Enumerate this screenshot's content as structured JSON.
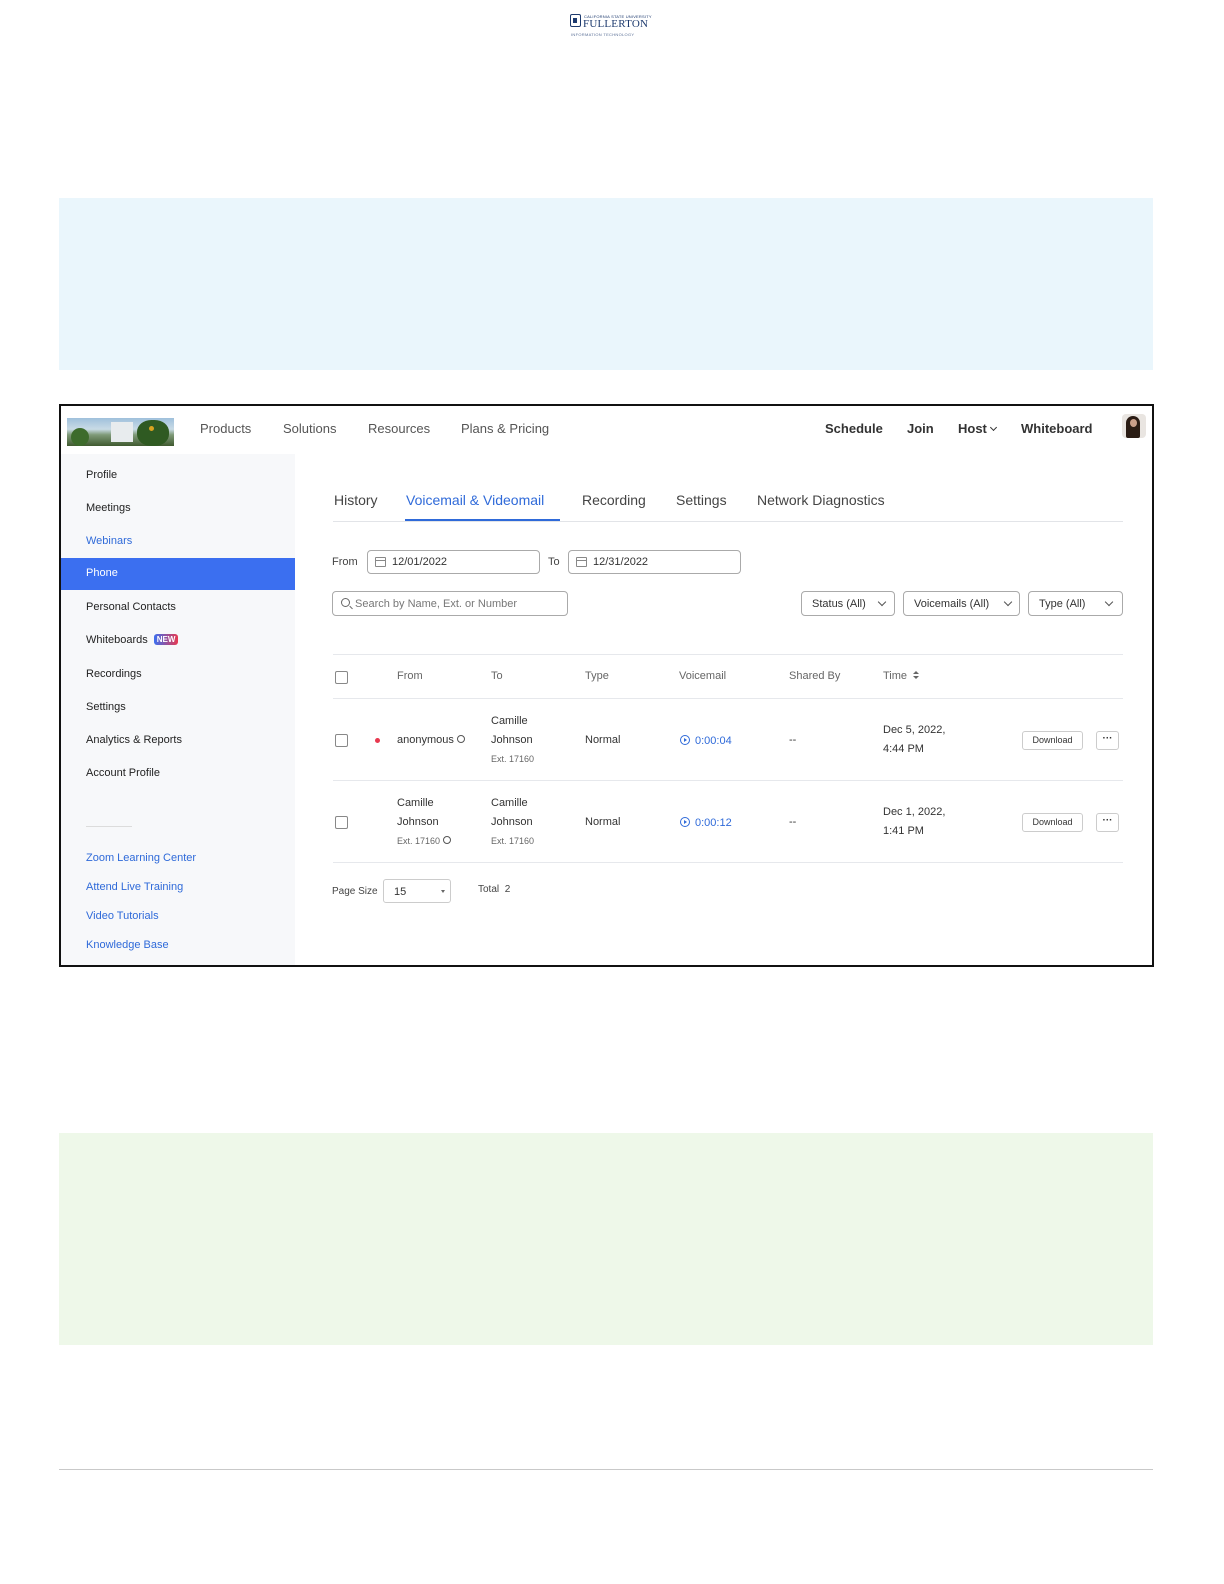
{
  "logo": {
    "top_text": "CALIFORNIA STATE UNIVERSITY",
    "main_text": "FULLERTON",
    "sub_text": "INFORMATION TECHNOLOGY"
  },
  "topnav": {
    "left": [
      "Products",
      "Solutions",
      "Resources",
      "Plans & Pricing"
    ],
    "right": [
      "Schedule",
      "Join",
      "Host",
      "Whiteboard"
    ]
  },
  "sidebar": {
    "items": [
      "Profile",
      "Meetings",
      "Webinars",
      "Phone",
      "Personal Contacts",
      "Whiteboards",
      "Recordings",
      "Settings",
      "Analytics & Reports",
      "Account Profile"
    ],
    "badge": "NEW",
    "links": [
      "Zoom Learning Center",
      "Attend Live Training",
      "Video Tutorials",
      "Knowledge Base"
    ]
  },
  "tabs": [
    "History",
    "Voicemail & Videomail",
    "Recording",
    "Settings",
    "Network Diagnostics"
  ],
  "filters": {
    "from_label": "From",
    "from_date": "12/01/2022",
    "to_label": "To",
    "to_date": "12/31/2022",
    "search_placeholder": "Search by Name, Ext. or Number",
    "status": "Status (All)",
    "voicemails": "Voicemails (All)",
    "type": "Type (All)"
  },
  "table": {
    "headers": [
      "From",
      "To",
      "Type",
      "Voicemail",
      "Shared By",
      "Time"
    ],
    "rows": [
      {
        "from_l1": "anonymous",
        "from_l2": "",
        "from_ext": "",
        "to_l1": "Camille",
        "to_l2": "Johnson",
        "to_ext": "Ext. 17160",
        "type": "Normal",
        "voicemail": "0:00:04",
        "shared_by": "--",
        "time_l1": "Dec 5, 2022,",
        "time_l2": "4:44 PM",
        "download": "Download",
        "more": "···"
      },
      {
        "from_l1": "Camille",
        "from_l2": "Johnson",
        "from_ext": "Ext. 17160",
        "to_l1": "Camille",
        "to_l2": "Johnson",
        "to_ext": "Ext. 17160",
        "type": "Normal",
        "voicemail": "0:00:12",
        "shared_by": "--",
        "time_l1": "Dec 1, 2022,",
        "time_l2": "1:41 PM",
        "download": "Download",
        "more": "···"
      }
    ]
  },
  "pagination": {
    "page_size_label": "Page Size",
    "page_size": "15",
    "total_label": "Total",
    "total": "2"
  }
}
